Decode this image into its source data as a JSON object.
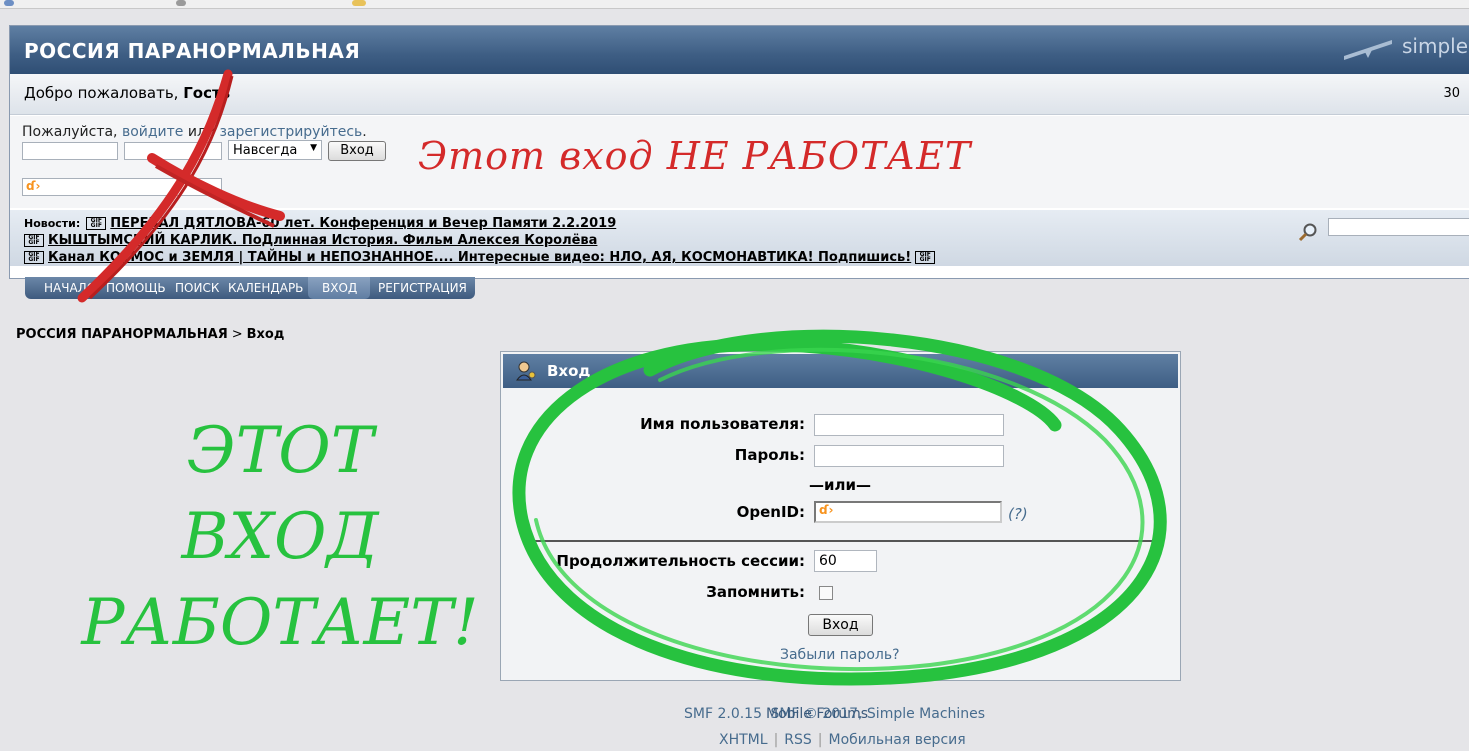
{
  "forum": {
    "title": "РОССИЯ ПАРАНОРМАЛЬНАЯ",
    "logo_text": "simple",
    "welcome_prefix": "Добро пожаловать,",
    "welcome_user": "Гость",
    "date_fragment": "30"
  },
  "quick_login": {
    "intro_prefix": "Пожалуйста,",
    "intro_link_login": "войдите",
    "intro_or": "или",
    "intro_link_register": "зарегистрируйтесь",
    "intro_suffix": ".",
    "duration_value": "Навсегда",
    "button_label": "Вход"
  },
  "news": {
    "label": "Новости:",
    "items": [
      "ПЕРЕВАЛ ДЯТЛОВА-60 лет. Конференция и Вечер Памяти 2.2.2019",
      "КЫШТЫМСКИЙ КАРЛИК. ПоДлинная История. Фильм Алексея Королёва",
      "Канал КОСМОС и ЗЕМЛЯ | ТАЙНЫ и НЕПОЗНАННОЕ.... Интересные видео: НЛО, АЯ, КОСМОНАВТИКА! Подпишись!"
    ]
  },
  "menu": {
    "items": [
      "НАЧАЛО",
      "ПОМОЩЬ",
      "ПОИСК",
      "КАЛЕНДАРЬ",
      "ВХОД",
      "РЕГИСТРАЦИЯ"
    ],
    "active": "ВХОД"
  },
  "breadcrumb": {
    "root": "РОССИЯ ПАРАНОРМАЛЬНАЯ",
    "separator": ">",
    "current": "Вход"
  },
  "login_form": {
    "title": "Вход",
    "username_label": "Имя пользователя:",
    "password_label": "Пароль:",
    "or_text": "—или—",
    "openid_label": "OpenID:",
    "openid_help": "(?)",
    "session_label": "Продолжительность сессии:",
    "session_value": "60",
    "remember_label": "Запомнить:",
    "submit_label": "Вход",
    "forgot_link": "Забыли пароль?"
  },
  "footer": {
    "copyright_a": "SMF 2.0.15",
    "copyright_b": "SMF © 2017",
    "copyright_c": "Simple Machines",
    "overlap_text": "Mobile Forums",
    "links": [
      "XHTML",
      "RSS",
      "Мобильная версия"
    ]
  },
  "annotations": {
    "not_working": "Этот вход НЕ РАБОТАЕТ",
    "working_lines": [
      "ЭТОТ",
      "ВХОД",
      "РАБОТАЕТ!"
    ]
  },
  "colors": {
    "header_blue": "#3e5e84",
    "link_blue": "#476c8e",
    "red_annotation": "#d42a2a",
    "green_annotation": "#27c23f"
  }
}
